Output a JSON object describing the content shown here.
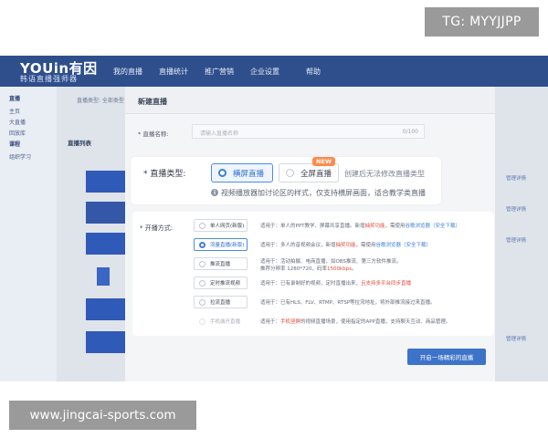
{
  "watermarks": {
    "tg": "TG: MYYJJPP",
    "url": "www.jingcai-sports.com"
  },
  "app": {
    "logo": "YOUin有因",
    "logo_sub": "韩语直播强师器",
    "nav": [
      "我的直播",
      "直播统计",
      "推广营销",
      "企业设置",
      "帮助"
    ]
  },
  "sidebar": {
    "items": [
      "直播",
      "主页",
      "大直播",
      "回放库",
      "课程",
      "组织学习"
    ]
  },
  "background": {
    "breadcrumb": "直播类型: 全部类型 · 直播状态 · 全部",
    "list_title": "直播列表",
    "right_links": [
      "管理详情",
      "管理详情",
      "管理详情",
      "管理详情"
    ]
  },
  "modal": {
    "title": "新建直播",
    "name_label": "* 直播名称:",
    "name_placeholder": "请输入直播名称",
    "name_count": "0/100",
    "type_label": "* 直播类型:",
    "type_options": [
      {
        "label": "横屏直播",
        "selected": true
      },
      {
        "label": "全屏直播",
        "selected": false
      }
    ],
    "new_badge": "NEW",
    "type_note": "创建后无法修改直播类型",
    "type_tip": "视频播放器加讨论区的样式，仅支持横屏画面，适合教学类直播",
    "mode_label": "* 开播方式:",
    "modes": [
      {
        "label": "单人网页(新版)",
        "selected": false,
        "disabled": false,
        "desc_pre": "适用于：单人的PPT教学、屏幕共享直播。新增",
        "desc_red": "抽奖功能",
        "desc_mid": "，需使用",
        "desc_blue": "谷歌浏览器（安全下载）",
        "desc_post": ""
      },
      {
        "label": "流量直播(新版)",
        "selected": true,
        "disabled": false,
        "desc_pre": "适用于：多人的音视频会议，新增",
        "desc_red": "抽奖功能",
        "desc_mid": "，需使用",
        "desc_blue": "谷歌浏览器（安全下载）",
        "desc_post": ""
      },
      {
        "label": "推流直播",
        "selected": false,
        "disabled": false,
        "desc_pre": "适用于：活动拍摄、电商直播，如OBS推流、第三方软件推流。",
        "desc_red": "",
        "desc_mid": "",
        "desc_blue": "",
        "desc_post": ""
      },
      {
        "label": "定时推流视频",
        "selected": false,
        "disabled": false,
        "desc_pre": "适用于：已有录制好的视频，定时直播出来，",
        "desc_red": "且支持多平台同步直播",
        "desc_mid": "",
        "desc_blue": "",
        "desc_post": ""
      },
      {
        "label": "拉流直播",
        "selected": false,
        "disabled": false,
        "desc_pre": "适用于：已有HLS、FLV、RTMP、RTSP等拉流地址，将外部推流接过来直播。",
        "desc_red": "",
        "desc_mid": "",
        "desc_blue": "",
        "desc_post": ""
      },
      {
        "label": "手机端开直播",
        "selected": false,
        "disabled": true,
        "desc_pre": "适用于：",
        "desc_red": "手机竖屏",
        "desc_mid": "的视频直播场景，使用指定的APP直播，支持聊天互动、商品管理。",
        "desc_blue": "",
        "desc_post": ""
      }
    ],
    "mode_extra_line": "推荐分辨率 1280*720，码率1500kbps。",
    "submit": "开启一场精彩的直播"
  },
  "colors": {
    "nav_bg": "#2f4f8c",
    "accent": "#3d7fd8",
    "highlight": "#e34a3a",
    "badge": "#ff8a4a"
  }
}
